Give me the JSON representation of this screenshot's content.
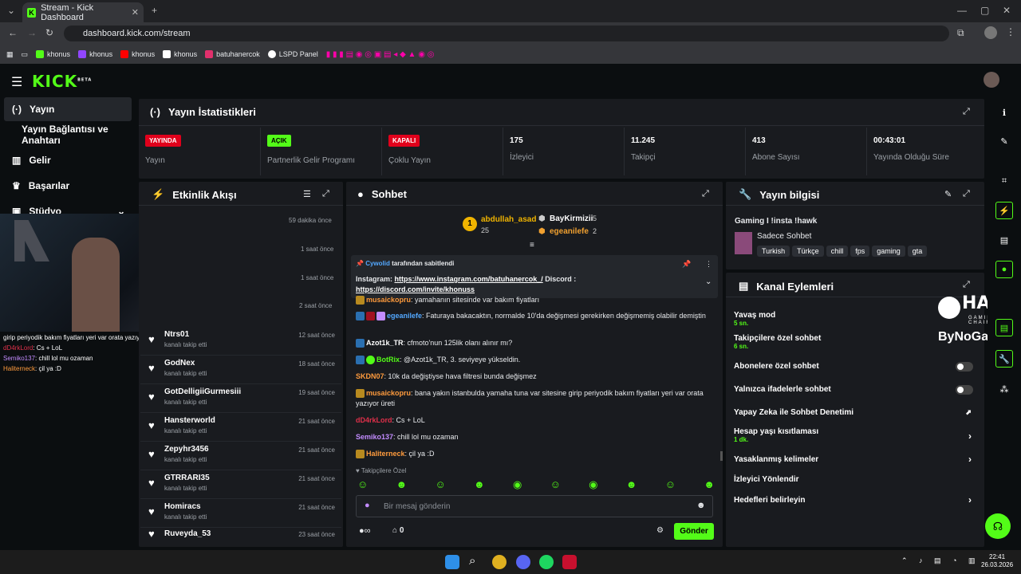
{
  "browser": {
    "tab_title": "Stream - Kick Dashboard",
    "url": "dashboard.kick.com/stream",
    "bookmarks": [
      {
        "label": "khonus",
        "color": "#53fc18"
      },
      {
        "label": "khonus",
        "color": "#9146ff"
      },
      {
        "label": "khonus",
        "color": "#ff0000"
      },
      {
        "label": "khonus",
        "color": "#ffffff"
      },
      {
        "label": "batuhanercok",
        "color": "#e1306c"
      },
      {
        "label": "LSPD Panel",
        "color": "#ffffff"
      }
    ]
  },
  "app": {
    "logo": "KICK",
    "logo_beta": "BETA",
    "brand_color": "#53fc18"
  },
  "sidebar": {
    "items": [
      {
        "label": "Yayın",
        "icon": "broadcast-icon"
      },
      {
        "label": "Yayın Bağlantısı ve Anahtarı",
        "icon": ""
      },
      {
        "label": "Gelir",
        "icon": "chart-icon"
      },
      {
        "label": "Başarılar",
        "icon": "trophy-icon"
      },
      {
        "label": "Stüdyo",
        "icon": "studio-icon"
      }
    ]
  },
  "stats": {
    "title": "Yayın İstatistikleri",
    "items": [
      {
        "badge": "YAYINDA",
        "badge_color": "#e0001b",
        "label": "Yayın"
      },
      {
        "badge": "AÇIK",
        "badge_color": "#53fc18",
        "label": "Partnerlik Gelir Programı"
      },
      {
        "badge": "KAPALI",
        "badge_color": "#e0001b",
        "label": "Çoklu Yayın"
      },
      {
        "value": "175",
        "label": "İzleyici"
      },
      {
        "value": "11.245",
        "label": "Takipçi"
      },
      {
        "value": "413",
        "label": "Abone Sayısı"
      },
      {
        "value": "00:43:01",
        "label": "Yayında Olduğu Süre"
      }
    ]
  },
  "activity": {
    "title": "Etkinlik Akışı",
    "top_times": [
      "59 dakika önce",
      "1 saat önce",
      "1 saat önce",
      "2 saat önce"
    ],
    "rows": [
      {
        "name": "Ntrs01",
        "sub": "kanalı takip etti",
        "time": "12 saat önce"
      },
      {
        "name": "GodNex",
        "sub": "kanalı takip etti",
        "time": "18 saat önce"
      },
      {
        "name": "GotDelligiiGurmesiii",
        "sub": "kanalı takip etti",
        "time": "19 saat önce"
      },
      {
        "name": "Hansterworld",
        "sub": "kanalı takip etti",
        "time": "21 saat önce"
      },
      {
        "name": "Zepyhr3456",
        "sub": "kanalı takip etti",
        "time": "21 saat önce"
      },
      {
        "name": "GTRRARI35",
        "sub": "kanalı takip etti",
        "time": "21 saat önce"
      },
      {
        "name": "Homiracs",
        "sub": "kanalı takip etti",
        "time": "21 saat önce"
      },
      {
        "name": "Ruveyda_53",
        "sub": "",
        "time": "23 saat önce"
      }
    ]
  },
  "overlay_chat": [
    {
      "user": "",
      "text": "girip periyodik bakım fiyatları yeri var orata yazıyor üreti",
      "color": "#ffffff"
    },
    {
      "user": "dD4rkLord",
      "text": ": Cs + LoL",
      "color": "#e0304a"
    },
    {
      "user": "Semiko137",
      "text": ": chill lol mu ozaman",
      "color": "#c38cff"
    },
    {
      "user": "Haliterneck",
      "text": ": çil ya :D",
      "color": "#ff9b3d"
    }
  ],
  "chat": {
    "title": "Sohbet",
    "top_gifters": [
      {
        "name": "abdullah_asad",
        "count": "25",
        "rank": "1"
      },
      {
        "name": "BayKirmizii",
        "count": "5"
      },
      {
        "name": "egeanilefe",
        "count": "2"
      }
    ],
    "pinned": {
      "by_user": "Cywolid",
      "by_text": " tarafından sabitlendi",
      "prefix": "Instagram: ",
      "link1": "https://www.instagram.com/batuhanercok_/",
      "mid": " Discord :",
      "link2": "https://discord.com/invite/khonuss"
    },
    "messages": [
      {
        "user": "musaickopru",
        "text": ": yamahanın sitesinde var bakım fiyatları",
        "color": "#ff9b3d"
      },
      {
        "user": "egeanilefe",
        "text": ": Faturaya bakacaktın, normalde 10'da değişmesi gerekirken değişmemiş olabilir demiştin",
        "color": "#53a8ff"
      },
      {
        "user": "Azot1k_TR",
        "text": ": cfmoto'nun 125lik olanı alınır mı?",
        "color": "#ffffff"
      },
      {
        "user": "BotRix",
        "text": ": @Azot1k_TR, 3. seviyeye yükseldin.",
        "color": "#53fc18"
      },
      {
        "user": "SKDN07",
        "text": ": 10k da değiştiyse hava filtresi bunda değişmez",
        "color": "#ff9b3d"
      },
      {
        "user": "musaickopru",
        "text": ": bana yakın istanbulda yamaha tuna var sitesine girip periyodik bakım fiyatları yeri var orata yazıyor üreti",
        "color": "#ff9b3d"
      },
      {
        "user": "dD4rkLord",
        "text": ": Cs + LoL",
        "color": "#e0304a"
      },
      {
        "user": "Semiko137",
        "text": ": chill lol mu ozaman",
        "color": "#c38cff"
      },
      {
        "user": "Haliterneck",
        "text": ": çil ya :D",
        "color": "#ff9b3d"
      }
    ],
    "followers_only": "Takipçilere Özel",
    "placeholder": "Bir mesaj gönderin",
    "points": "0",
    "send": "Gönder"
  },
  "stream_info": {
    "title": "Yayın bilgisi",
    "stream_title": "Gaming I !insta !hawk",
    "category": "Sadece Sohbet",
    "tags": [
      "Turkish",
      "Türkçe",
      "chill",
      "fps",
      "gaming",
      "gta"
    ]
  },
  "channel_actions": {
    "title": "Kanal Eylemleri",
    "items": [
      {
        "label": "Yavaş mod",
        "sub": "5 sn.",
        "ctl": ""
      },
      {
        "label": "Takipçilere özel sohbet",
        "sub": "6 sn.",
        "ctl": ""
      },
      {
        "label": "Abonelere özel sohbet",
        "sub": "",
        "ctl": "toggle"
      },
      {
        "label": "Yalnızca ifadelerle sohbet",
        "sub": "",
        "ctl": "toggle"
      },
      {
        "label": "Yapay Zeka ile Sohbet Denetimi",
        "sub": "",
        "ctl": "ext"
      },
      {
        "label": "Hesap yaşı kısıtlaması",
        "sub": "1 dk.",
        "ctl": "chevron"
      },
      {
        "label": "Yasaklanmış kelimeler",
        "sub": "",
        "ctl": "chevron"
      },
      {
        "label": "İzleyici Yönlendir",
        "sub": "",
        "ctl": ""
      },
      {
        "label": "Hedefleri belirleyin",
        "sub": "",
        "ctl": "chevron"
      }
    ],
    "sponsor1": "HAWK",
    "sponsor1_sub": "GAMING CHAIR",
    "sponsor2": "ByNoGame"
  },
  "taskbar": {
    "time": "22:41",
    "date": "26.03.2026"
  }
}
